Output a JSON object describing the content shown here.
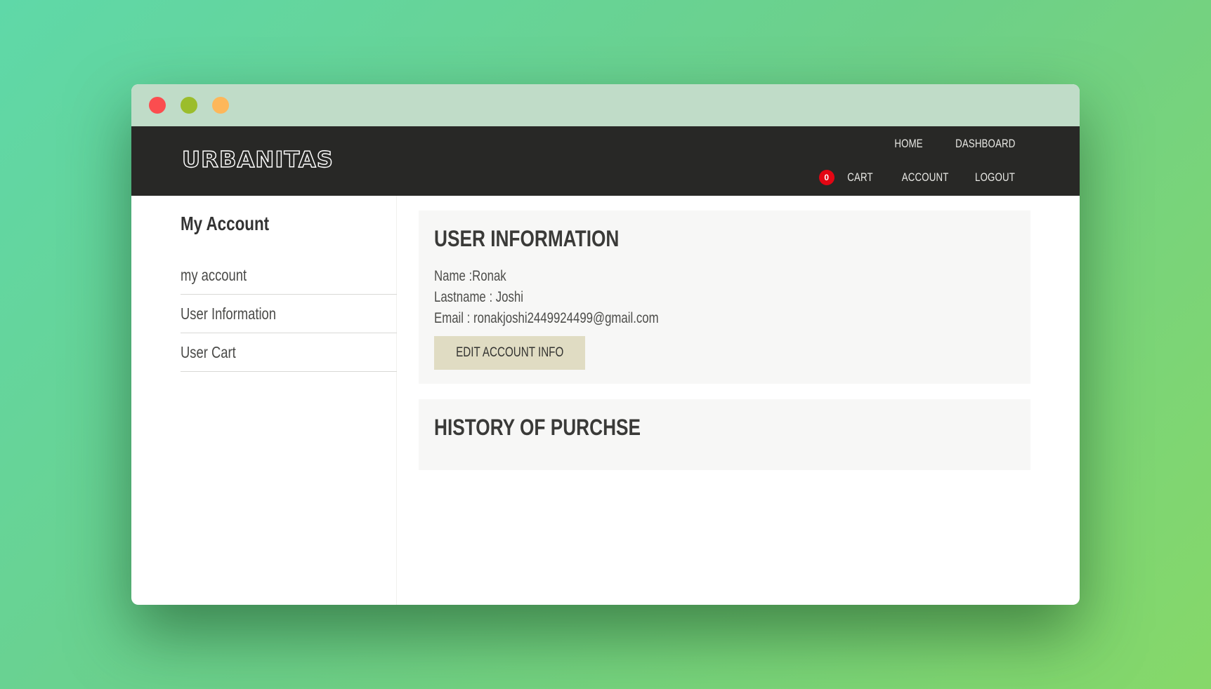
{
  "brand": {
    "logo_text": "URBANITAS"
  },
  "nav": {
    "home": "HOME",
    "dashboard": "DASHBOARD",
    "cart_count": "0",
    "cart": "CART",
    "account": "ACCOUNT",
    "logout": "LOGOUT"
  },
  "sidebar": {
    "title": "My Account",
    "items": [
      {
        "label": "my account"
      },
      {
        "label": "User Information"
      },
      {
        "label": "User Cart"
      }
    ]
  },
  "user_info": {
    "heading": "USER INFORMATION",
    "name_line": "Name :Ronak",
    "lastname_line": "Lastname : Joshi",
    "email_line": "Email : ronakjoshi2449924499@gmail.com",
    "edit_button": "EDIT ACCOUNT INFO"
  },
  "history": {
    "heading": "HISTORY OF PURCHSE"
  },
  "colors": {
    "navbar": "#282826",
    "badge": "#e30613",
    "button": "#e0dcc3",
    "card": "#f7f7f6"
  }
}
